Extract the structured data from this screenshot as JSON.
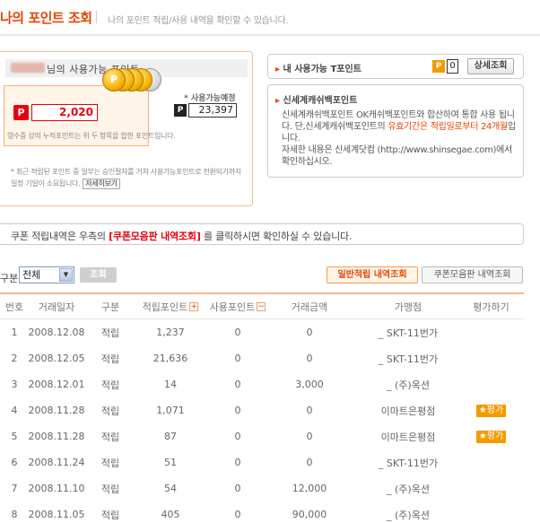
{
  "header": {
    "title": "나의 포인트 조회",
    "subtitle": "나의 포인트 적립/사용 내역을 확인할 수 있습니다."
  },
  "points": {
    "name_suffix": "님의 사용가능 포인트",
    "badge": "P",
    "current_value": "2,020",
    "coin_letter": "P",
    "available_label": "* 사용가능예정",
    "available_badge": "P",
    "available_value": "23,397",
    "note1": "영수증 상의 누적포인트는 위 두 항목을 합한 포인트입니다.",
    "note2": "* 최근 적립된 포인트 중 일부는 승인절차를 거쳐 사용가능포인트로 전환되기까지 일정 기일이 소요됩니다.",
    "detail_button": "자세히보기"
  },
  "tpoint": {
    "label": "내 사용가능 T포인트",
    "badge": "P",
    "value": "0",
    "button": "상세조회"
  },
  "cashback": {
    "label": "신세계캐쉬백포인트",
    "text_a": "신세계캐쉬백포인트 OK캐쉬백포인트와 합산하여 통합 사용 됩니다. 단,신세계캐쉬백포인트의 ",
    "text_hl": "유효기간은 적립일로부터 24개월",
    "text_b": "입니다.",
    "text_c": "자세한 내용은 신세계닷컴 (http://www.shinsegae.com)에서 확인하십시오."
  },
  "notice": {
    "text_a": "쿠폰 적립내역은 우측의 ",
    "link": "[쿠폰모음판 내역조회]",
    "text_b": " 를 클릭하시면 확인하실 수 있습니다."
  },
  "filter": {
    "label": "구분",
    "selected": "전체",
    "go_button": "조회",
    "tab_normal": "일반적립 내역조회",
    "tab_coupon": "쿠폰모음판 내역조회"
  },
  "table": {
    "columns": [
      "번호",
      "거래일자",
      "구분",
      "적립포인트",
      "사용포인트",
      "거래금액",
      "가맹점",
      "평가하기"
    ],
    "rate_label": "평가",
    "rows": [
      {
        "no": "1",
        "date": "2008.12.08",
        "type": "적립",
        "earn": "1,237",
        "use": "0",
        "amount": "0",
        "store": "_ SKT-11번가",
        "rate": false
      },
      {
        "no": "2",
        "date": "2008.12.05",
        "type": "적립",
        "earn": "21,636",
        "use": "0",
        "amount": "0",
        "store": "_ SKT-11번가",
        "rate": false
      },
      {
        "no": "3",
        "date": "2008.12.01",
        "type": "적립",
        "earn": "14",
        "use": "0",
        "amount": "3,000",
        "store": "_ (주)옥션",
        "rate": false
      },
      {
        "no": "4",
        "date": "2008.11.28",
        "type": "적립",
        "earn": "1,071",
        "use": "0",
        "amount": "0",
        "store": "이마트은평점",
        "rate": true
      },
      {
        "no": "5",
        "date": "2008.11.28",
        "type": "적립",
        "earn": "87",
        "use": "0",
        "amount": "0",
        "store": "이마트은평점",
        "rate": true
      },
      {
        "no": "6",
        "date": "2008.11.24",
        "type": "적립",
        "earn": "51",
        "use": "0",
        "amount": "0",
        "store": "_ SKT-11번가",
        "rate": false
      },
      {
        "no": "7",
        "date": "2008.11.10",
        "type": "적립",
        "earn": "54",
        "use": "0",
        "amount": "12,000",
        "store": "_ (주)옥션",
        "rate": false
      },
      {
        "no": "8",
        "date": "2008.11.05",
        "type": "적립",
        "earn": "405",
        "use": "0",
        "amount": "90,000",
        "store": "_ (주)옥션",
        "rate": false
      }
    ]
  }
}
